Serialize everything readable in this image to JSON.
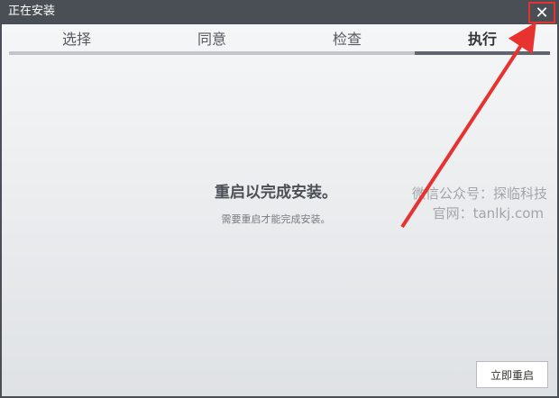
{
  "window": {
    "title": "正在安装"
  },
  "tabs": [
    {
      "label": "选择"
    },
    {
      "label": "同意"
    },
    {
      "label": "检查"
    },
    {
      "label": "执行"
    }
  ],
  "main": {
    "heading": "重启以完成安装。",
    "subtext": "需要重启才能完成安装。",
    "restart_button": "立即重启"
  },
  "watermark": {
    "line1": "微信公众号：探临科技",
    "line2": "官网：tanlkj.com"
  },
  "icons": {
    "close": "✕"
  },
  "colors": {
    "annotation": "#e8322f",
    "active_tab_bar": "#5f6670"
  }
}
